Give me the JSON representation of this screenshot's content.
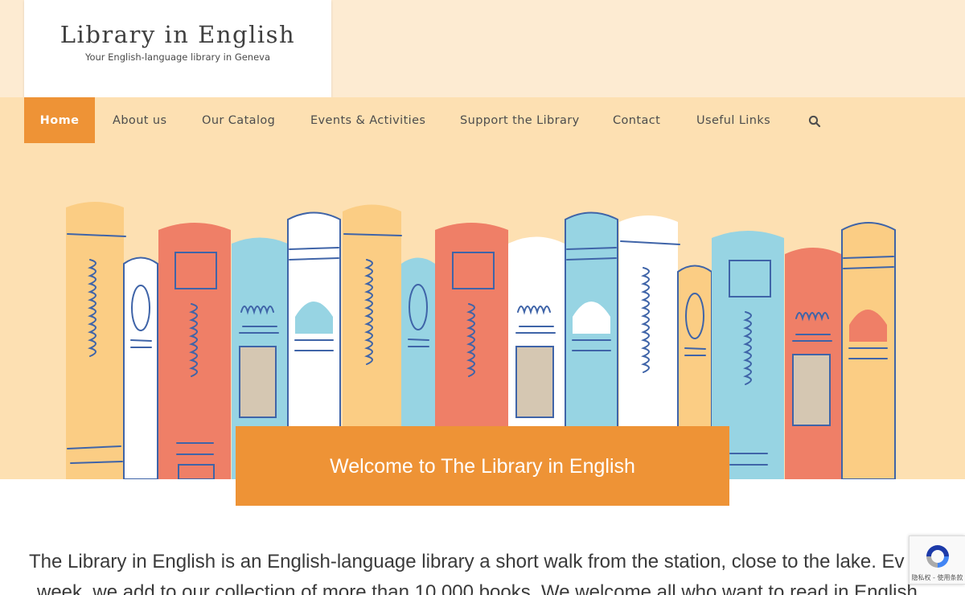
{
  "site": {
    "title": "Library in English",
    "tagline": "Your English-language library in Geneva"
  },
  "nav": {
    "items": [
      {
        "label": "Home",
        "active": true
      },
      {
        "label": "About us"
      },
      {
        "label": "Our Catalog"
      },
      {
        "label": "Events & Activities"
      },
      {
        "label": "Support the Library"
      },
      {
        "label": "Contact"
      },
      {
        "label": "Useful Links"
      }
    ],
    "search_icon": "search-icon"
  },
  "hero": {
    "welcome": "Welcome to The Library in English"
  },
  "intro": {
    "line1": "The Library in English is an English-language library a short walk from the station, close to the lake. Ev",
    "line2": "week, we add to our collection of more than 10,000 books. We welcome all who want to read in English"
  },
  "recaptcha": {
    "text": "隐私权 - 使用条款"
  },
  "colors": {
    "accent": "#ee9336",
    "nav_bg": "#fde0b2",
    "top_band": "#fdebd2"
  }
}
